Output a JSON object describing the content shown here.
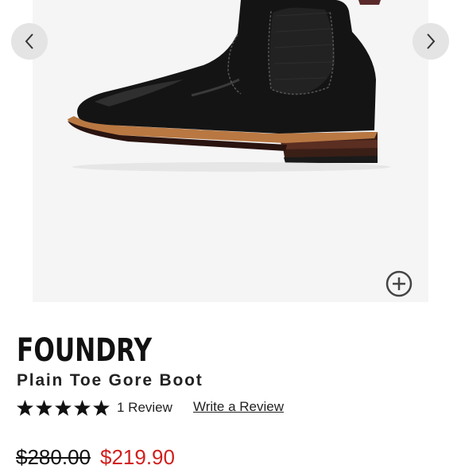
{
  "gallery": {
    "prev_icon": "chevron-left-icon",
    "next_icon": "chevron-right-icon",
    "zoom_icon": "zoom-plus-circle-icon"
  },
  "product": {
    "brand": "FOUNDRY",
    "name": "Plain Toe Gore Boot",
    "rating": {
      "stars": 5,
      "max": 5,
      "review_count_label": "1 Review"
    },
    "write_review_label": "Write a Review",
    "price": {
      "original": "$280.00",
      "sale": "$219.90"
    }
  },
  "colors": {
    "sale_price": "#d0201e",
    "gallery_bg": "#f5f5f5",
    "nav_button_bg": "#e4e4e4"
  }
}
